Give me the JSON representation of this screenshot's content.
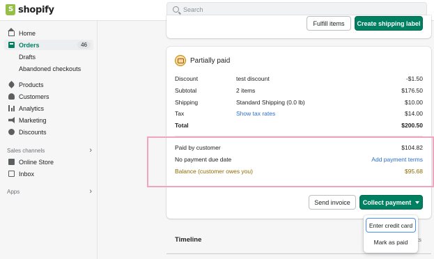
{
  "app": {
    "logo_text": "shopify"
  },
  "search": {
    "placeholder": "Search"
  },
  "sidebar": {
    "items": [
      {
        "label": "Home",
        "icon": "home-icon"
      },
      {
        "label": "Orders",
        "icon": "orders-icon",
        "badge": "46"
      },
      {
        "label": "Products",
        "icon": "tag-icon"
      },
      {
        "label": "Customers",
        "icon": "person-icon"
      },
      {
        "label": "Analytics",
        "icon": "bar-chart-icon"
      },
      {
        "label": "Marketing",
        "icon": "megaphone-icon"
      },
      {
        "label": "Discounts",
        "icon": "discount-icon"
      }
    ],
    "order_subitems": [
      "Drafts",
      "Abandoned checkouts"
    ],
    "sales_channels": {
      "heading": "Sales channels",
      "items": [
        {
          "label": "Online Store",
          "icon": "store-icon"
        },
        {
          "label": "Inbox",
          "icon": "inbox-icon"
        }
      ]
    },
    "apps_heading": "Apps"
  },
  "fulfillment": {
    "fulfill_button": "Fulfill items",
    "shipping_label_button": "Create shipping label"
  },
  "payment": {
    "title": "Partially paid",
    "lines": [
      {
        "label": "Discount",
        "detail": "test discount",
        "amount": "-$1.50"
      },
      {
        "label": "Subtotal",
        "detail": "2 items",
        "amount": "$176.50"
      },
      {
        "label": "Shipping",
        "detail": "Standard Shipping (0.0 lb)",
        "amount": "$10.00"
      },
      {
        "label": "Tax",
        "detail": "Show tax rates",
        "amount": "$14.00"
      },
      {
        "label": "Total",
        "detail": "",
        "amount": "$200.50"
      }
    ],
    "paid_by_customer": {
      "label": "Paid by customer",
      "amount": "$104.82"
    },
    "due_date": {
      "label": "No payment due date",
      "action": "Add payment terms"
    },
    "balance": {
      "label": "Balance (customer owes you)",
      "amount": "$95.68"
    },
    "send_invoice_button": "Send invoice",
    "collect_payment_button": "Collect payment"
  },
  "collect_menu": {
    "items": [
      "Enter credit card",
      "Mark as paid"
    ]
  },
  "timeline": {
    "title": "Timeline",
    "trailing": "ts"
  },
  "colors": {
    "primary": "#008060",
    "link": "#2c6ecb",
    "balance_text": "#916a00",
    "highlight_border": "#f2a3bf",
    "status_badge": "#ffd79d"
  }
}
